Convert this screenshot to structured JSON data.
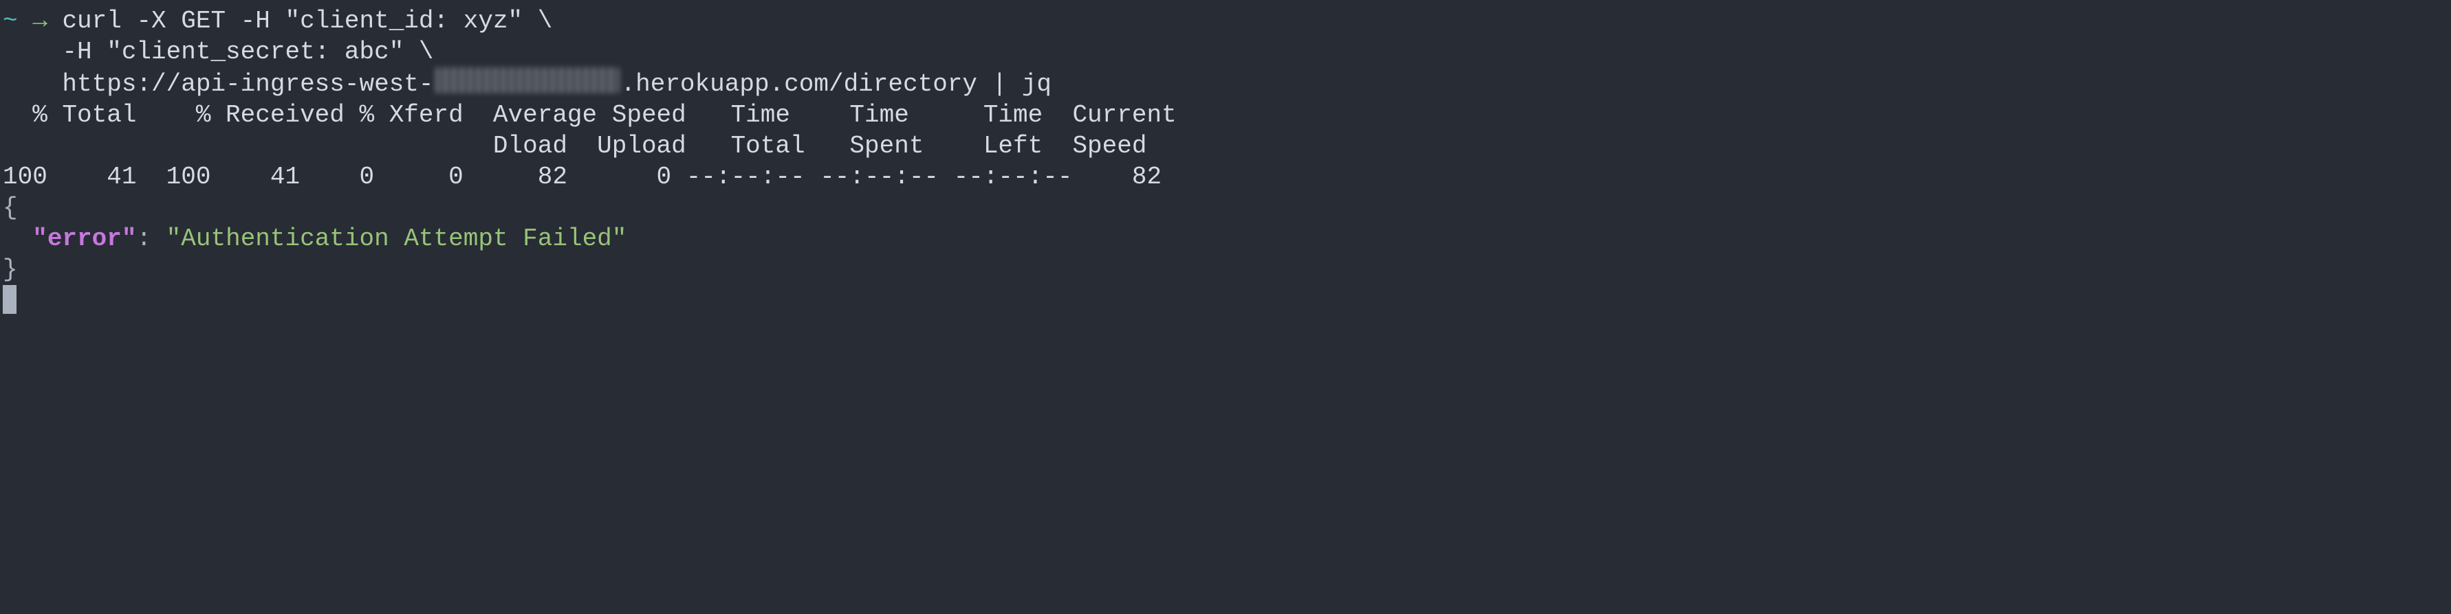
{
  "prompt": {
    "tilde": "~",
    "arrow": "→"
  },
  "command": {
    "line1": "curl -X GET -H \"client_id: xyz\" \\",
    "line2": "    -H \"client_secret: abc\" \\",
    "line3_prefix": "    https://api-ingress-west-",
    "line3_suffix": ".herokuapp.com/directory | jq"
  },
  "progress": {
    "header1": "  % Total    % Received % Xferd  Average Speed   Time    Time     Time  Current",
    "header2": "                                 Dload  Upload   Total   Spent    Left  Speed",
    "row": "100    41  100    41    0     0     82      0 --:--:-- --:--:-- --:--:--    82"
  },
  "json": {
    "open": "{",
    "indent": "  ",
    "keyq": "\"error\"",
    "colon": ": ",
    "valq": "\"Authentication Attempt Failed\"",
    "close": "}"
  }
}
